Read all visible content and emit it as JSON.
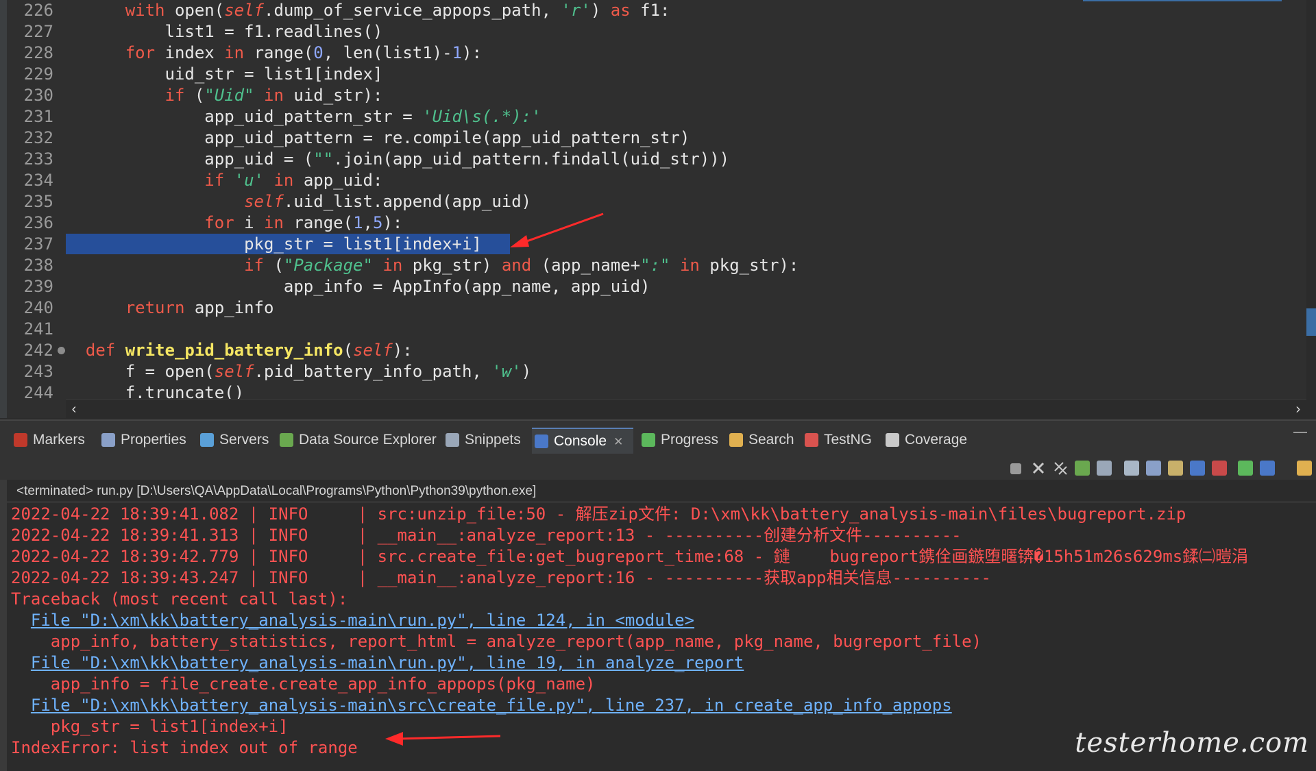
{
  "editor": {
    "lines": [
      {
        "num": "226",
        "tokens": [
          [
            "      ",
            ""
          ],
          [
            "with",
            "kw"
          ],
          [
            " open(",
            ""
          ],
          [
            "self",
            "self"
          ],
          [
            ".dump_of_service_appops_path, ",
            ""
          ],
          [
            "'r'",
            "str"
          ],
          [
            ") ",
            ""
          ],
          [
            "as",
            "kw"
          ],
          [
            " f1:",
            ""
          ]
        ]
      },
      {
        "num": "227",
        "tokens": [
          [
            "          list1 = f1.readlines()",
            ""
          ]
        ]
      },
      {
        "num": "228",
        "tokens": [
          [
            "      ",
            ""
          ],
          [
            "for",
            "kw"
          ],
          [
            " index ",
            ""
          ],
          [
            "in",
            "kw"
          ],
          [
            " range(",
            ""
          ],
          [
            "0",
            "num"
          ],
          [
            ", len(list1)-",
            ""
          ],
          [
            "1",
            "num"
          ],
          [
            "):",
            ""
          ]
        ]
      },
      {
        "num": "229",
        "tokens": [
          [
            "          uid_str = list1[index]",
            ""
          ]
        ]
      },
      {
        "num": "230",
        "tokens": [
          [
            "          ",
            ""
          ],
          [
            "if",
            "kw"
          ],
          [
            " (",
            ""
          ],
          [
            "\"Uid\"",
            "str"
          ],
          [
            " ",
            ""
          ],
          [
            "in",
            "kw"
          ],
          [
            " uid_str):",
            ""
          ]
        ]
      },
      {
        "num": "231",
        "tokens": [
          [
            "              app_uid_pattern_str = ",
            ""
          ],
          [
            "'Uid\\s(.*):'",
            "str"
          ]
        ]
      },
      {
        "num": "232",
        "tokens": [
          [
            "              app_uid_pattern = re.compile(app_uid_pattern_str)",
            ""
          ]
        ]
      },
      {
        "num": "233",
        "tokens": [
          [
            "              app_uid = (",
            ""
          ],
          [
            "\"\"",
            "str"
          ],
          [
            ".join(app_uid_pattern.findall(uid_str)))",
            ""
          ]
        ]
      },
      {
        "num": "234",
        "tokens": [
          [
            "              ",
            ""
          ],
          [
            "if",
            "kw"
          ],
          [
            " ",
            ""
          ],
          [
            "'u'",
            "str"
          ],
          [
            " ",
            ""
          ],
          [
            "in",
            "kw"
          ],
          [
            " app_uid:",
            ""
          ]
        ]
      },
      {
        "num": "235",
        "tokens": [
          [
            "                  ",
            ""
          ],
          [
            "self",
            "self"
          ],
          [
            ".uid_list.append(app_uid)",
            ""
          ]
        ]
      },
      {
        "num": "236",
        "tokens": [
          [
            "              ",
            ""
          ],
          [
            "for",
            "kw"
          ],
          [
            " i ",
            ""
          ],
          [
            "in",
            "kw"
          ],
          [
            " range(",
            ""
          ],
          [
            "1",
            "num"
          ],
          [
            ",",
            ""
          ],
          [
            "5",
            "num"
          ],
          [
            "):",
            ""
          ]
        ]
      },
      {
        "num": "237",
        "tokens": [
          [
            "                  pkg_str = list1[index+i]",
            ""
          ]
        ]
      },
      {
        "num": "238",
        "tokens": [
          [
            "                  ",
            ""
          ],
          [
            "if",
            "kw"
          ],
          [
            " (",
            ""
          ],
          [
            "\"Package\"",
            "str"
          ],
          [
            " ",
            ""
          ],
          [
            "in",
            "kw"
          ],
          [
            " pkg_str) ",
            ""
          ],
          [
            "and",
            "kw"
          ],
          [
            " (app_name+",
            ""
          ],
          [
            "\":\"",
            "str"
          ],
          [
            " ",
            ""
          ],
          [
            "in",
            "kw"
          ],
          [
            " pkg_str):",
            ""
          ]
        ]
      },
      {
        "num": "239",
        "tokens": [
          [
            "                      app_info = AppInfo(app_name, app_uid)",
            ""
          ]
        ]
      },
      {
        "num": "240",
        "tokens": [
          [
            "      ",
            ""
          ],
          [
            "return",
            "kw"
          ],
          [
            " app_info",
            ""
          ]
        ]
      },
      {
        "num": "241",
        "tokens": [
          [
            "",
            ""
          ]
        ]
      },
      {
        "num": "242",
        "tokens": [
          [
            "  ",
            ""
          ],
          [
            "def",
            "kw"
          ],
          [
            " ",
            ""
          ],
          [
            "write_pid_battery_info",
            "fn"
          ],
          [
            "(",
            ""
          ],
          [
            "self",
            "self"
          ],
          [
            "):",
            ""
          ]
        ]
      },
      {
        "num": "243",
        "tokens": [
          [
            "      f = open(",
            ""
          ],
          [
            "self",
            "self"
          ],
          [
            ".pid_battery_info_path, ",
            ""
          ],
          [
            "'w'",
            "str"
          ],
          [
            ")",
            ""
          ]
        ]
      },
      {
        "num": "244",
        "tokens": [
          [
            "      f.truncate()",
            ""
          ]
        ]
      }
    ],
    "scroll_left": "‹",
    "scroll_right": "›"
  },
  "tabs": [
    {
      "label": "Markers",
      "icon": "markers-icon",
      "color": "#c0392b"
    },
    {
      "label": "Properties",
      "icon": "properties-icon",
      "color": "#8aa0c8"
    },
    {
      "label": "Servers",
      "icon": "servers-icon",
      "color": "#5aa0d8"
    },
    {
      "label": "Data Source Explorer",
      "icon": "data-source-icon",
      "color": "#6aa84f"
    },
    {
      "label": "Snippets",
      "icon": "snippets-icon",
      "color": "#9aa7b8"
    },
    {
      "label": "Console",
      "icon": "console-icon",
      "color": "#4a78c8",
      "active": true,
      "close": "✕"
    },
    {
      "label": "Progress",
      "icon": "progress-icon",
      "color": "#5cb85c"
    },
    {
      "label": "Search",
      "icon": "search-icon",
      "color": "#e0b050"
    },
    {
      "label": "TestNG",
      "icon": "testng-icon",
      "color": "#d9534f"
    },
    {
      "label": "Coverage",
      "icon": "coverage-icon",
      "color": "#c9c9c9"
    }
  ],
  "minimize_label": "—",
  "console": {
    "header": "<terminated> run.py [D:\\Users\\QA\\AppData\\Local\\Programs\\Python\\Python39\\python.exe]",
    "lines": [
      [
        [
          "2022-04-22 18:39:41.082 | INFO     | src:unzip_file:50 - 解压zip文件: D:\\xm\\kk\\battery_analysis-main\\files\\bugreport.zip",
          ""
        ]
      ],
      [
        [
          "2022-04-22 18:39:41.313 | INFO     | __main__:analyze_report:13 - ----------创建分析文件----------",
          ""
        ]
      ],
      [
        [
          "2022-04-22 18:39:42.779 | INFO     | src.create_file:get_bugreport_time:68 - 鏈    bugreport鎸佺画鏃堕暱锛�15h51m26s629ms鍒㈡暟涓",
          ""
        ]
      ],
      [
        [
          "2022-04-22 18:39:43.247 | INFO     | __main__:analyze_report:16 - ----------获取app相关信息----------",
          ""
        ]
      ],
      [
        [
          "Traceback (most recent call last):",
          ""
        ]
      ],
      [
        [
          "  ",
          ""
        ],
        [
          "File \"D:\\xm\\kk\\battery_analysis-main\\run.py\", line 124, in <module>",
          "link"
        ]
      ],
      [
        [
          "    app_info, battery_statistics, report_html = analyze_report(app_name, pkg_name, bugreport_file)",
          ""
        ]
      ],
      [
        [
          "  ",
          ""
        ],
        [
          "File \"D:\\xm\\kk\\battery_analysis-main\\run.py\", line 19, in analyze_report",
          "link"
        ]
      ],
      [
        [
          "    app_info = file_create.create_app_info_appops(pkg_name)",
          ""
        ]
      ],
      [
        [
          "  ",
          ""
        ],
        [
          "File \"D:\\xm\\kk\\battery_analysis-main\\src\\create_file.py\", line 237, in create_app_info_appops",
          "link"
        ]
      ],
      [
        [
          "    pkg_str = list1[index+i]",
          ""
        ]
      ],
      [
        [
          "IndexError: list index out of range",
          ""
        ]
      ]
    ]
  },
  "watermark": "testerhome.com",
  "colors": {
    "keyword": "#ee5a4a",
    "string": "#4fc08d",
    "error": "#ff5252",
    "link": "#6fb3ff",
    "selection": "#264f9a",
    "arrow": "#ff2a2a"
  }
}
